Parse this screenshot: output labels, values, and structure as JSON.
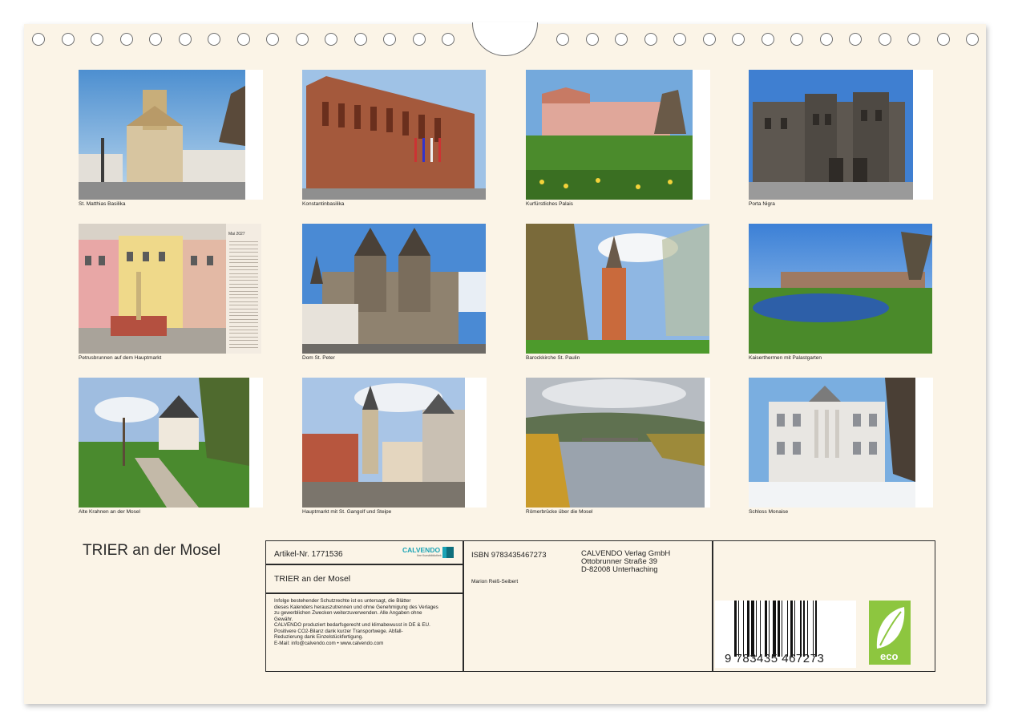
{
  "title": "TRIER an der Mosel",
  "photos": [
    {
      "caption": "St. Matthias Basilika"
    },
    {
      "caption": "Konstantinbasilika"
    },
    {
      "caption": "Kurfürstliches Palais"
    },
    {
      "caption": "Porta Nigra"
    },
    {
      "caption": "Petrusbrunnen auf dem Hauptmarkt"
    },
    {
      "caption": "Dom St. Peter"
    },
    {
      "caption": "Barockkirche St. Paulin"
    },
    {
      "caption": "Kaiserthermen mit Palastgarten"
    },
    {
      "caption": "Alte Krahnen an der Mosel"
    },
    {
      "caption": "Hauptmarkt mit St. Gangolf und Steipe"
    },
    {
      "caption": "Römerbrücke über die Mosel"
    },
    {
      "caption": "Schloss Monaise"
    }
  ],
  "calendar_strip": {
    "month": "Mai 2027"
  },
  "info": {
    "article": "Artikel-Nr. 1771536",
    "brand": "CALVENDO",
    "brand_sub": "Ihre Kunstbibliothek",
    "title": "TRIER an der Mosel",
    "legal": [
      "Infolge bestehender Schutzrechte ist es untersagt, die Blätter",
      "dieses Kalenders herauszutrennen und ohne Genehmigung des Verlages",
      "zu gewerblichen Zwecken weiterzuverwenden. Alle Angaben ohne",
      "Gewähr.",
      "CALVENDO produziert bedarfsgerecht und klimabewusst in DE & EU.",
      "Positivere CO2-Bilanz dank kurzer Transportwege. Abfall-",
      "Reduzierung dank Einzelstückfertigung.",
      "E-Mail: info@calvendo.com • www.calvendo.com"
    ],
    "isbn": "ISBN 9783435467273",
    "author": "Marion Reiß-Seibert",
    "publisher": [
      "CALVENDO Verlag GmbH",
      "Ottobrunner Straße 39",
      "D-82008 Unterhaching"
    ],
    "barcode_digits": "9  783435  467273",
    "eco_label": "eco"
  },
  "colors": {
    "paper": "#fbf4e7",
    "eco_green": "#8dc63f",
    "calvendo_teal": "#1aa3b5"
  }
}
